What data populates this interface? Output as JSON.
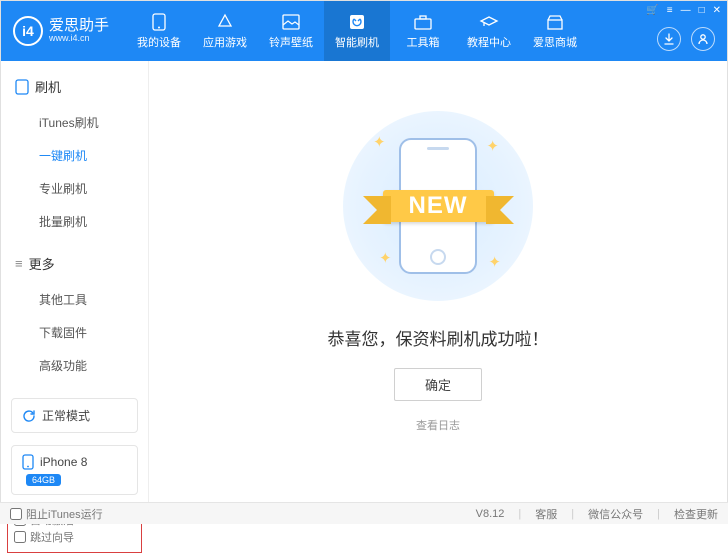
{
  "brand": {
    "title": "爱思助手",
    "url": "www.i4.cn",
    "logo_text": "i4"
  },
  "nav": [
    {
      "label": "我的设备"
    },
    {
      "label": "应用游戏"
    },
    {
      "label": "铃声壁纸"
    },
    {
      "label": "智能刷机"
    },
    {
      "label": "工具箱"
    },
    {
      "label": "教程中心"
    },
    {
      "label": "爱思商城"
    }
  ],
  "nav_active_index": 3,
  "sidebar": {
    "group1_title": "刷机",
    "group1_items": [
      "iTunes刷机",
      "一键刷机",
      "专业刷机",
      "批量刷机"
    ],
    "group1_active_index": 1,
    "group2_title": "更多",
    "group2_items": [
      "其他工具",
      "下载固件",
      "高级功能"
    ],
    "mode_label": "正常模式",
    "device_name": "iPhone 8",
    "device_storage": "64GB",
    "chk_auto_activate": "自动激活",
    "chk_skip_wizard": "跳过向导"
  },
  "main": {
    "ribbon_text": "NEW",
    "success_message": "恭喜您，保资料刷机成功啦！",
    "ok_button": "确定",
    "view_log": "查看日志"
  },
  "footer": {
    "block_itunes": "阻止iTunes运行",
    "version": "V8.12",
    "support": "客服",
    "wechat": "微信公众号",
    "check_update": "检查更新"
  }
}
